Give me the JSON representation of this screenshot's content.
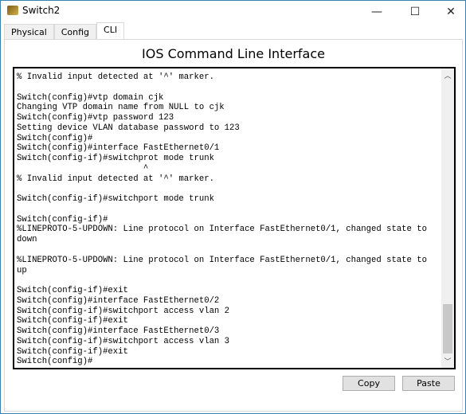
{
  "window": {
    "title": "Switch2",
    "minimize": "—",
    "maximize": "☐",
    "close": "✕"
  },
  "tabs": [
    {
      "label": "Physical"
    },
    {
      "label": "Config"
    },
    {
      "label": "CLI"
    }
  ],
  "cli": {
    "heading": "IOS Command Line Interface",
    "lines": [
      "% Invalid input detected at '^' marker.",
      "",
      "Switch(config)#vtp domain cjk",
      "Changing VTP domain name from NULL to cjk",
      "Switch(config)#vtp password 123",
      "Setting device VLAN database password to 123",
      "Switch(config)#",
      "Switch(config)#interface FastEthernet0/1",
      "Switch(config-if)#switchprot mode trunk",
      "                         ^",
      "% Invalid input detected at '^' marker.",
      "",
      "Switch(config-if)#switchport mode trunk",
      "",
      "Switch(config-if)#",
      "%LINEPROTO-5-UPDOWN: Line protocol on Interface FastEthernet0/1, changed state to",
      "down",
      "",
      "%LINEPROTO-5-UPDOWN: Line protocol on Interface FastEthernet0/1, changed state to",
      "up",
      "",
      "Switch(config-if)#exit",
      "Switch(config)#interface FastEthernet0/2",
      "Switch(config-if)#switchport access vlan 2",
      "Switch(config-if)#exit",
      "Switch(config)#interface FastEthernet0/3",
      "Switch(config-if)#switchport access vlan 3",
      "Switch(config-if)#exit",
      "Switch(config)#"
    ],
    "copy_label": "Copy",
    "paste_label": "Paste"
  }
}
